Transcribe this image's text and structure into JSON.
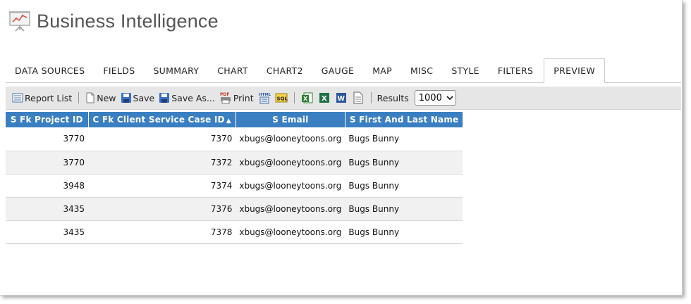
{
  "app": {
    "title": "Business Intelligence",
    "logo_icon": "presentation-chart-icon"
  },
  "tabs": [
    {
      "label": "DATA SOURCES"
    },
    {
      "label": "FIELDS"
    },
    {
      "label": "SUMMARY"
    },
    {
      "label": "CHART"
    },
    {
      "label": "CHART2"
    },
    {
      "label": "GAUGE"
    },
    {
      "label": "MAP"
    },
    {
      "label": "MISC"
    },
    {
      "label": "STYLE"
    },
    {
      "label": "FILTERS"
    },
    {
      "label": "PREVIEW",
      "active": true
    }
  ],
  "toolbar": {
    "report_list": "Report List",
    "new": "New",
    "save": "Save",
    "save_as": "Save As...",
    "print": "Print",
    "results_label": "Results",
    "results_value": "1000"
  },
  "table": {
    "headers": [
      "S Fk Project ID",
      "C Fk Client Service Case ID",
      "S Email",
      "S First And Last Name"
    ],
    "sort_indicator": "▲",
    "rows": [
      [
        "3770",
        "7370",
        "xbugs@looneytoons.org",
        "Bugs Bunny"
      ],
      [
        "3770",
        "7372",
        "xbugs@looneytoons.org",
        "Bugs Bunny"
      ],
      [
        "3948",
        "7374",
        "xbugs@looneytoons.org",
        "Bugs Bunny"
      ],
      [
        "3435",
        "7376",
        "xbugs@looneytoons.org",
        "Bugs Bunny"
      ],
      [
        "3435",
        "7378",
        "xbugs@looneytoons.org",
        "Bugs Bunny"
      ]
    ]
  },
  "colors": {
    "header_bg": "#3a7fc1",
    "toolbar_bg": "#e6e6e6",
    "alt_row": "#f1f1f1"
  }
}
